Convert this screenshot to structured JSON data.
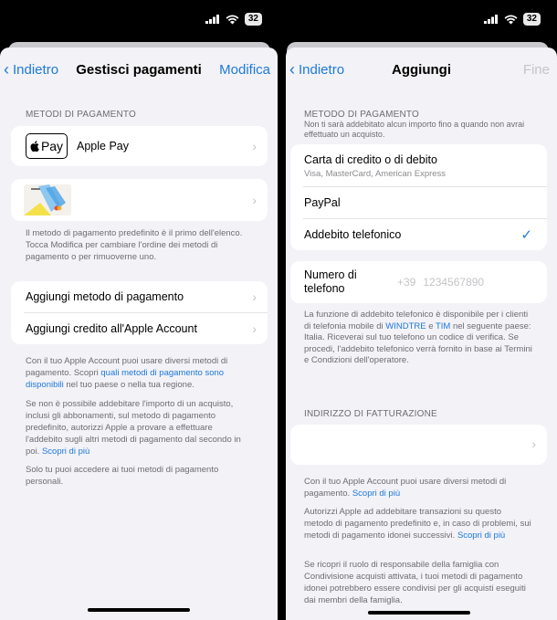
{
  "status": {
    "battery": "32"
  },
  "left": {
    "nav": {
      "back": "Indietro",
      "title": "Gestisci pagamenti",
      "right": "Modifica"
    },
    "section_title": "METODI DI PAGAMENTO",
    "apple_pay": {
      "logo": "Pay",
      "label": "Apple Pay"
    },
    "card_note": "Il metodo di pagamento predefinito è il primo dell'elenco. Tocca Modifica per cambiare l'ordine dei metodi di pagamento o per rimuoverne uno.",
    "actions": [
      "Aggiungi metodo di pagamento",
      "Aggiungi credito all'Apple Account"
    ],
    "info1_a": "Con il tuo Apple Account puoi usare diversi metodi di pagamento. Scopri ",
    "info1_link": "quali metodi di pagamento sono disponibili",
    "info1_b": " nel tuo paese o nella tua regione.",
    "info2_a": "Se non è possibile addebitare l'importo di un acquisto, inclusi gli abbonamenti, sul metodo di pagamento predefinito, autorizzi Apple a provare a effettuare l'addebito sugli altri metodi di pagamento dal secondo in poi. ",
    "info2_link": "Scopri di più",
    "info3": "Solo tu puoi accedere ai tuoi metodi di pagamento personali."
  },
  "right": {
    "nav": {
      "back": "Indietro",
      "title": "Aggiungi",
      "right": "Fine"
    },
    "section_title": "METODO DI PAGAMENTO",
    "section_sub": "Non ti sarà addebitato alcun importo fino a quando non avrai effettuato un acquisto.",
    "methods": {
      "card_title": "Carta di credito o di debito",
      "card_sub": "Visa, MasterCard, American Express",
      "paypal": "PayPal",
      "phone_billing": "Addebito telefonico"
    },
    "phone_field": {
      "label": "Numero di telefono",
      "prefix": "+39",
      "placeholder": "1234567890"
    },
    "phone_note_a": "La funzione di addebito telefonico è disponibile per i clienti di telefonia mobile di ",
    "phone_note_windtre": "WINDTRE",
    "phone_note_e": " e ",
    "phone_note_tim": "TIM",
    "phone_note_b": " nel seguente paese: Italia. Riceverai sul tuo telefono un codice di verifica. Se procedi, l'addebito telefonico verrà fornito in base ai Termini e Condizioni dell'operatore.",
    "billing_title": "INDIRIZZO DI FATTURAZIONE",
    "info1_a": "Con il tuo Apple Account puoi usare diversi metodi di pagamento. ",
    "info1_link": "Scopri di più",
    "info2_a": "Autorizzi Apple ad addebitare transazioni su questo metodo di pagamento predefinito e, in caso di problemi, sui metodi di pagamento idonei successivi. ",
    "info2_link": "Scopri di più",
    "info3": "Se ricopri il ruolo di responsabile della famiglia con Condivisione acquisti attivata, i tuoi metodi di pagamento idonei potrebbero essere condivisi per gli acquisti eseguiti dai membri della famiglia."
  },
  "colors": {
    "accent": "#1f79d8",
    "background": "#f2f2f7"
  }
}
